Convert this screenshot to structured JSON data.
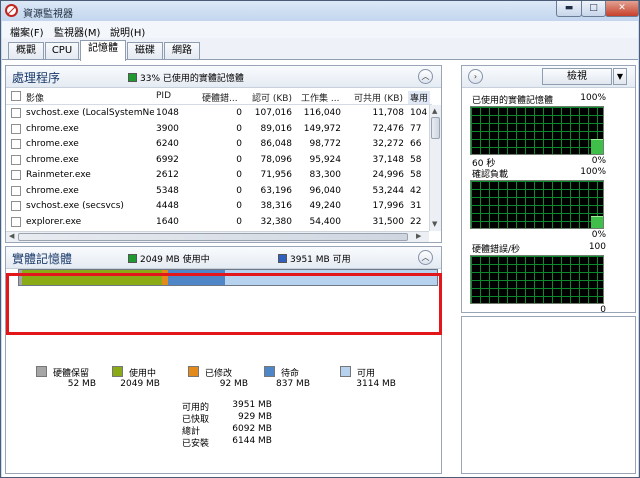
{
  "window": {
    "title": "資源監視器",
    "minimize": "▬",
    "maximize": "□",
    "close": "✕"
  },
  "menu": [
    "檔案(F)",
    "監視器(M)",
    "說明(H)"
  ],
  "tabs": [
    "概觀",
    "CPU",
    "記憶體",
    "磁碟",
    "網路"
  ],
  "processes": {
    "title": "處理程序",
    "summary": "33% 已使用的實體記憶體",
    "columns": [
      "影像",
      "PID",
      "硬體錯...",
      "認可 (KB)",
      "工作集 ...",
      "可共用 (KB)",
      "專用"
    ],
    "rows": [
      {
        "image": "svchost.exe (LocalSystemNe...",
        "pid": "1048",
        "faults": "0",
        "commit": "107,016",
        "ws": "116,040",
        "share": "11,708",
        "priv": "104"
      },
      {
        "image": "chrome.exe",
        "pid": "3900",
        "faults": "0",
        "commit": "89,016",
        "ws": "149,972",
        "share": "72,476",
        "priv": "77"
      },
      {
        "image": "chrome.exe",
        "pid": "6240",
        "faults": "0",
        "commit": "86,048",
        "ws": "98,772",
        "share": "32,272",
        "priv": "66"
      },
      {
        "image": "chrome.exe",
        "pid": "6992",
        "faults": "0",
        "commit": "78,096",
        "ws": "95,924",
        "share": "37,148",
        "priv": "58"
      },
      {
        "image": "Rainmeter.exe",
        "pid": "2612",
        "faults": "0",
        "commit": "71,956",
        "ws": "83,300",
        "share": "24,996",
        "priv": "58"
      },
      {
        "image": "chrome.exe",
        "pid": "5348",
        "faults": "0",
        "commit": "63,196",
        "ws": "96,040",
        "share": "53,244",
        "priv": "42"
      },
      {
        "image": "svchost.exe (secsvcs)",
        "pid": "4448",
        "faults": "0",
        "commit": "38,316",
        "ws": "49,240",
        "share": "17,996",
        "priv": "31"
      },
      {
        "image": "explorer.exe",
        "pid": "1640",
        "faults": "0",
        "commit": "32,380",
        "ws": "54,400",
        "share": "31,500",
        "priv": "22"
      }
    ]
  },
  "physical": {
    "title": "實體記憶體",
    "used_label": "2049 MB 使用中",
    "avail_label": "3951 MB 可用",
    "colors": {
      "reserved": "#a6a6a6",
      "inuse": "#8aaa16",
      "modified": "#e48a1a",
      "standby": "#4f86c8",
      "free": "#b7d2ef"
    },
    "bar_fraction": {
      "reserved": 0.008,
      "inuse": 0.333,
      "modified": 0.015,
      "standby": 0.136,
      "free": 0.507
    },
    "legend": [
      {
        "key": "reserved",
        "label": "硬體保留",
        "value": "52 MB"
      },
      {
        "key": "inuse",
        "label": "使用中",
        "value": "2049 MB"
      },
      {
        "key": "modified",
        "label": "已修改",
        "value": "92 MB"
      },
      {
        "key": "standby",
        "label": "待命",
        "value": "837 MB"
      },
      {
        "key": "free",
        "label": "可用",
        "value": "3114 MB"
      }
    ],
    "stats": [
      {
        "label": "可用的",
        "value": "3951 MB"
      },
      {
        "label": "已快取",
        "value": "929 MB"
      },
      {
        "label": "總計",
        "value": "6092 MB"
      },
      {
        "label": "已安裝",
        "value": "6144 MB"
      }
    ]
  },
  "side": {
    "nav_icon": "chevron-right-icon",
    "view_label": "檢視",
    "graphs": [
      {
        "title": "已使用的實體記憶體",
        "max": "100%",
        "left_foot": "60 秒",
        "right_foot": "0%",
        "level": 0.33
      },
      {
        "title": "確認負載",
        "max": "100%",
        "left_foot": "",
        "right_foot": "0%",
        "level": 0.25
      },
      {
        "title": "硬體錯誤/秒",
        "max": "100",
        "left_foot": "",
        "right_foot": "0",
        "level": 0.0
      }
    ]
  }
}
